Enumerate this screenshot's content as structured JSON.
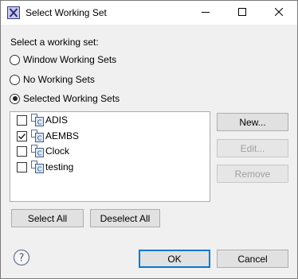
{
  "window": {
    "title": "Select Working Set",
    "app_icon": "eclipse-working-set-icon",
    "controls": [
      "minimize-icon",
      "maximize-icon",
      "close-icon"
    ]
  },
  "prompt": "Select a working set:",
  "options": [
    {
      "label": "Window Working Sets",
      "selected": false
    },
    {
      "label": "No Working Sets",
      "selected": false
    },
    {
      "label": "Selected Working Sets",
      "selected": true
    }
  ],
  "working_sets": [
    {
      "label": "ADIS",
      "checked": false,
      "icon": "working-set-icon"
    },
    {
      "label": "AEMBS",
      "checked": true,
      "icon": "working-set-icon"
    },
    {
      "label": "Clock",
      "checked": false,
      "icon": "working-set-icon"
    },
    {
      "label": "testing",
      "checked": false,
      "icon": "working-set-icon"
    }
  ],
  "side_buttons": {
    "new": "New...",
    "edit": "Edit...",
    "remove": "Remove"
  },
  "selection_buttons": {
    "select_all": "Select All",
    "deselect_all": "Deselect All"
  },
  "footer": {
    "help_icon": "help-icon",
    "ok": "OK",
    "cancel": "Cancel"
  },
  "colors": {
    "accent": "#0078d7",
    "titlebar": "#ffffff",
    "dialog_bg": "#f0f0f0",
    "disabled_text": "#a0a0a0"
  }
}
